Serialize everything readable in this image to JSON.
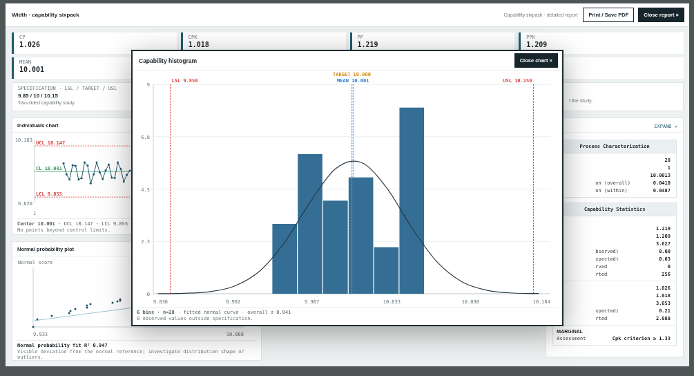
{
  "report": {
    "title": "Width · capability sixpack",
    "subtitle": "Capability sixpack · detailed report",
    "buttons": [
      {
        "label": "Print / Save PDF",
        "kind": "outline"
      },
      {
        "label": "Close report ×",
        "kind": "primary"
      }
    ]
  },
  "kpis": [
    {
      "label": "CP",
      "value": "1.026"
    },
    {
      "label": "CPK",
      "value": "1.018"
    },
    {
      "label": "PP",
      "value": "1.219"
    },
    {
      "label": "PPK",
      "value": "1.209"
    },
    {
      "label": "MEAN",
      "value": "10.001"
    }
  ],
  "specification": {
    "label": "SPECIFICATION · LSL / TARGET / USL",
    "value": "9.85 / 10 / 10.15",
    "note": "Two-sided capability study."
  },
  "study_note": {
    "text": "t the study."
  },
  "individuals_chart": {
    "title": "Individuals chart",
    "x_axis_label": "1",
    "chart_data": {
      "type": "line",
      "ylim": [
        9.82,
        10.183
      ],
      "yticks": [
        {
          "value": 9.82,
          "label": "9.820"
        },
        {
          "value": 10.183,
          "label": "10.183"
        }
      ],
      "series": [
        {
          "color": "#1f5a6e",
          "values": [
            10.048,
            9.985,
            9.955,
            10.037,
            10.033,
            9.955,
            9.963,
            10.053,
            10.035,
            9.933,
            9.985,
            10.053,
            9.997,
            9.958,
            10.008,
            10.041,
            9.966,
            9.964,
            10.053,
            10.015,
            9.943,
            9.982,
            10.005
          ]
        }
      ],
      "ref_lines": [
        {
          "axis": "y",
          "value": 10.147,
          "label": "UCL 10.147",
          "color": "#d93a3a"
        },
        {
          "axis": "y",
          "value": 10.001,
          "label": "CL 10.001",
          "color": "#3c9a5f"
        },
        {
          "axis": "y",
          "value": 9.855,
          "label": "LCL 9.855",
          "color": "#d93a3a"
        }
      ]
    },
    "summary": "**Center 10.001** · UCL 10.147 · LCL 9.855",
    "note": "No points beyond control limits."
  },
  "probability_plot": {
    "title": "Normal probability plot",
    "y_label": "Normal score",
    "x_ticks": [
      "9.933",
      "10.068"
    ],
    "summary": "Normal probability fit R² 0.947",
    "note": "Visible deviation from the normal reference; investigate distribution shape or outliers."
  },
  "stats_panel": {
    "expand_link": "EXPAND ↗",
    "tables": [
      {
        "title": "Process Characterization",
        "groups": [
          {
            "rows": [
              {
                "value": "28"
              },
              {
                "value": "1"
              },
              {
                "value": "10.0013"
              },
              {
                "label": "on (overall)",
                "value": "0.0410"
              },
              {
                "label": "on (within)",
                "value": "0.0487"
              }
            ]
          }
        ]
      },
      {
        "title": "Capability Statistics",
        "groups": [
          {
            "rows": [
              {
                "value": "1.219"
              },
              {
                "value": "1.209"
              },
              {
                "value": "3.627"
              },
              {
                "label": "bserved)",
                "value": "0.00"
              },
              {
                "label": "xpected)",
                "value": "0.03"
              },
              {
                "label": "rved",
                "value": "0"
              },
              {
                "label": "rted",
                "value": "256"
              }
            ]
          },
          {
            "rows": [
              {
                "value": "1.026"
              },
              {
                "value": "1.018"
              },
              {
                "value": "3.053"
              },
              {
                "label": "xpected)",
                "value": "0.21"
              },
              {
                "label": "rted",
                "value": "2.088"
              }
            ]
          },
          {
            "heading": "MARGINAL",
            "rows": [
              {
                "label": "Assessment",
                "value": "Cpk criterion ≥ 1.33"
              }
            ]
          }
        ]
      }
    ]
  },
  "histogram": {
    "title": "Capability histogram",
    "close_label": "Close chart ×",
    "chart_data": {
      "type": "bar",
      "grid": true,
      "xlim": [
        9.836,
        10.164
      ],
      "ylim": [
        0,
        9
      ],
      "x": [
        9.8395,
        9.8605,
        9.8815,
        9.9025,
        9.9235,
        9.9445,
        9.9655,
        9.9865,
        10.0075,
        10.0285,
        10.0495,
        10.0705,
        10.0915,
        10.1125,
        10.1335,
        10.1545
      ],
      "xticks": [
        9.836,
        9.902,
        9.967,
        10.033,
        10.098,
        10.164
      ],
      "yticks": [
        {
          "value": 0,
          "label": "0"
        },
        {
          "value": 2.25,
          "label": "2.3"
        },
        {
          "value": 4.5,
          "label": "4.5"
        },
        {
          "value": 6.75,
          "label": "6.8"
        },
        {
          "value": 9,
          "label": "9"
        }
      ],
      "series": [
        {
          "type": "bar",
          "color": "#346e94",
          "values": [
            null,
            null,
            null,
            null,
            null,
            3,
            6,
            4,
            5,
            2,
            8,
            null,
            null,
            null,
            null,
            null
          ]
        },
        {
          "type": "line",
          "color": "#2b3a44",
          "values": [
            0.0,
            0.02,
            0.08,
            0.32,
            0.96,
            2.21,
            3.93,
            5.37,
            5.65,
            4.57,
            2.84,
            1.36,
            0.5,
            0.14,
            0.03,
            0.01
          ]
        }
      ],
      "ref_lines": [
        {
          "axis": "x",
          "value": 9.85,
          "label": "LSL 9.850",
          "color": "#e04848"
        },
        {
          "axis": "x",
          "value": 10.0,
          "label": "TARGET 10.000",
          "color": "#d48a12"
        },
        {
          "axis": "x",
          "value": 10.001,
          "label": "MEAN 10.001",
          "color": "#2f7fd1"
        },
        {
          "axis": "x",
          "value": 10.15,
          "label": "USL 10.150",
          "color": "#e04848"
        }
      ]
    },
    "summary": "**6 bins · n=28** · fitted normal curve · overall σ 0.041",
    "note": "0 observed values outside specification."
  }
}
